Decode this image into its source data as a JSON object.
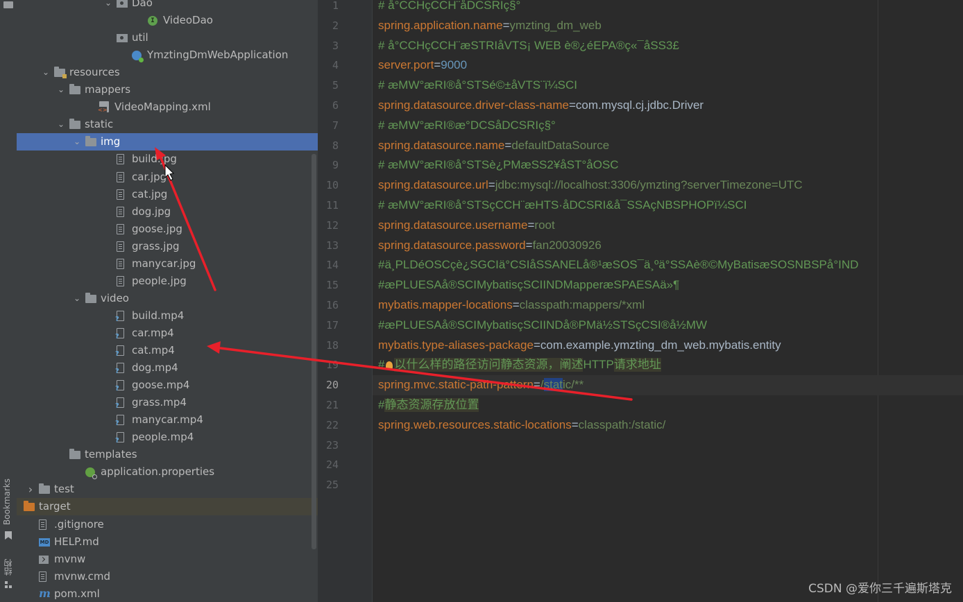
{
  "tool_strip": {
    "bookmarks_label": "Bookmarks",
    "structure_label": "结构"
  },
  "project_tree": {
    "items": [
      {
        "label": "Dao",
        "icon": "package-icon",
        "expanded": true
      },
      {
        "label": "VideoDao",
        "icon": "interface-icon"
      },
      {
        "label": "util",
        "icon": "package-icon"
      },
      {
        "label": "YmztingDmWebApplication",
        "icon": "spring-app-class-icon"
      },
      {
        "label": "resources",
        "icon": "resources-folder-icon",
        "expanded": true
      },
      {
        "label": "mappers",
        "icon": "folder-icon",
        "expanded": true
      },
      {
        "label": "VideoMapping.xml",
        "icon": "xml-file-icon"
      },
      {
        "label": "static",
        "icon": "folder-icon",
        "expanded": true
      },
      {
        "label": "img",
        "icon": "folder-icon",
        "expanded": true,
        "selected": true
      },
      {
        "label": "build.jpg",
        "icon": "image-file-icon"
      },
      {
        "label": "car.jpg",
        "icon": "image-file-icon"
      },
      {
        "label": "cat.jpg",
        "icon": "image-file-icon"
      },
      {
        "label": "dog.jpg",
        "icon": "image-file-icon"
      },
      {
        "label": "goose.jpg",
        "icon": "image-file-icon"
      },
      {
        "label": "grass.jpg",
        "icon": "image-file-icon"
      },
      {
        "label": "manycar.jpg",
        "icon": "image-file-icon"
      },
      {
        "label": "people.jpg",
        "icon": "image-file-icon"
      },
      {
        "label": "video",
        "icon": "folder-icon",
        "expanded": true
      },
      {
        "label": "build.mp4",
        "icon": "unknown-file-icon"
      },
      {
        "label": "car.mp4",
        "icon": "unknown-file-icon"
      },
      {
        "label": "cat.mp4",
        "icon": "unknown-file-icon"
      },
      {
        "label": "dog.mp4",
        "icon": "unknown-file-icon"
      },
      {
        "label": "goose.mp4",
        "icon": "unknown-file-icon"
      },
      {
        "label": "grass.mp4",
        "icon": "unknown-file-icon"
      },
      {
        "label": "manycar.mp4",
        "icon": "unknown-file-icon"
      },
      {
        "label": "people.mp4",
        "icon": "unknown-file-icon"
      },
      {
        "label": "templates",
        "icon": "folder-icon"
      },
      {
        "label": "application.properties",
        "icon": "properties-file-icon"
      },
      {
        "label": "test",
        "icon": "folder-icon",
        "expanded": false
      },
      {
        "label": "target",
        "icon": "excluded-folder-icon",
        "expanded": false
      },
      {
        "label": ".gitignore",
        "icon": "gitignore-file-icon"
      },
      {
        "label": "HELP.md",
        "icon": "markdown-file-icon"
      },
      {
        "label": "mvnw",
        "icon": "shell-script-icon"
      },
      {
        "label": "mvnw.cmd",
        "icon": "text-file-icon"
      },
      {
        "label": "pom.xml",
        "icon": "maven-icon"
      }
    ]
  },
  "editor": {
    "current_line": 20,
    "lines": [
      {
        "num": "1",
        "parts": [
          {
            "t": "# å°CCHçCCH¨åDCSRIç§°",
            "c": "c"
          }
        ]
      },
      {
        "num": "2",
        "parts": [
          {
            "t": "spring.application.name",
            "c": "k"
          },
          {
            "t": "=",
            "c": "e"
          },
          {
            "t": "ymzting_dm_web",
            "c": "v"
          }
        ]
      },
      {
        "num": "3",
        "parts": [
          {
            "t": "# å°CCHçCCH¨æSTRIåVTS¡ WEB è®¿éEPA®ç«¯åSS3£",
            "c": "c"
          }
        ]
      },
      {
        "num": "4",
        "parts": [
          {
            "t": "server.port",
            "c": "k"
          },
          {
            "t": "=",
            "c": "e"
          },
          {
            "t": "9000",
            "c": "n"
          }
        ]
      },
      {
        "num": "5",
        "parts": [
          {
            "t": "# æMW°æRI®å°STSé©±åVTS¨ï¼SCI",
            "c": "c"
          }
        ]
      },
      {
        "num": "6",
        "parts": [
          {
            "t": "spring.datasource.driver-class-name",
            "c": "k"
          },
          {
            "t": "=",
            "c": "e"
          },
          {
            "t": "com.mysql.cj.jdbc.Driver",
            "c": "e"
          }
        ]
      },
      {
        "num": "7",
        "parts": [
          {
            "t": "# æMW°æRI®æ°DCSåDCSRIç§°",
            "c": "c"
          }
        ]
      },
      {
        "num": "8",
        "parts": [
          {
            "t": "spring.datasource.name",
            "c": "k"
          },
          {
            "t": "=",
            "c": "e"
          },
          {
            "t": "defaultDataSource",
            "c": "v"
          }
        ]
      },
      {
        "num": "9",
        "parts": [
          {
            "t": "# æMW°æRI®å°STSè¿PMæSS2¥åST°åOSC",
            "c": "c"
          }
        ]
      },
      {
        "num": "10",
        "parts": [
          {
            "t": "spring.datasource.url",
            "c": "k"
          },
          {
            "t": "=",
            "c": "e"
          },
          {
            "t": "jdbc:mysql://localhost:3306/ymzting?serverTimezone=UTC",
            "c": "v"
          }
        ]
      },
      {
        "num": "11",
        "parts": [
          {
            "t": "# æMW°æRI®å°STSçCCH¨æHTS·åDCSRI&å¯SSAçNBSPHOPï¼SCI",
            "c": "c"
          }
        ]
      },
      {
        "num": "12",
        "parts": [
          {
            "t": "spring.datasource.username",
            "c": "k"
          },
          {
            "t": "=",
            "c": "e"
          },
          {
            "t": "root",
            "c": "v"
          }
        ]
      },
      {
        "num": "13",
        "parts": [
          {
            "t": "spring.datasource.password",
            "c": "k"
          },
          {
            "t": "=",
            "c": "e"
          },
          {
            "t": "fan20030926",
            "c": "v"
          }
        ]
      },
      {
        "num": "14",
        "parts": [
          {
            "t": "#ä¸PLDéOSCçè¿SGCIä°CSIåSSANELå®¹æSOS¯ä¸ºä°SSAè®©MyBatisæSOSNBSPå°IND",
            "c": "c"
          }
        ]
      },
      {
        "num": "15",
        "parts": [
          {
            "t": "#æPLUESAå®SCIMybatisçSCIINDMapperæSPAESAä»¶",
            "c": "c"
          }
        ]
      },
      {
        "num": "16",
        "parts": [
          {
            "t": "mybatis.mapper-locations",
            "c": "k"
          },
          {
            "t": "=",
            "c": "e"
          },
          {
            "t": "classpath:mappers/*xml",
            "c": "v"
          }
        ]
      },
      {
        "num": "17",
        "parts": [
          {
            "t": "#æPLUESAå®SCIMybatisçSCIINDå®PMä½STSçCSI®å½MW",
            "c": "c"
          }
        ]
      },
      {
        "num": "18",
        "parts": [
          {
            "t": "mybatis.type-aliases-package",
            "c": "k"
          },
          {
            "t": "=",
            "c": "e"
          },
          {
            "t": "com.example.ymzting_dm_web.mybatis.entity",
            "c": "e"
          }
        ]
      },
      {
        "num": "19",
        "parts": [
          {
            "t": "#",
            "c": "c"
          },
          {
            "t": "",
            "c": "bulb"
          },
          {
            "t": "以什么样的路径访问静态资源，阐述",
            "c": "cn"
          },
          {
            "t": "HTTP",
            "c": "c"
          },
          {
            "t": "请求地址",
            "c": "cn"
          }
        ]
      },
      {
        "num": "20",
        "parts": [
          {
            "t": "spring.mvc.static-path-pattern",
            "c": "k"
          },
          {
            "t": "=",
            "c": "e"
          },
          {
            "t": "/",
            "c": "v"
          },
          {
            "t": "stat",
            "c": "v sh"
          },
          {
            "t": "ic/**",
            "c": "v"
          }
        ]
      },
      {
        "num": "21",
        "parts": [
          {
            "t": "#",
            "c": "c"
          },
          {
            "t": "静态资源存放位置",
            "c": "cn"
          }
        ]
      },
      {
        "num": "22",
        "parts": [
          {
            "t": "spring.web.resources.static-locations",
            "c": "k"
          },
          {
            "t": "=",
            "c": "e"
          },
          {
            "t": "classpath:/static/",
            "c": "v"
          }
        ]
      },
      {
        "num": "23",
        "parts": []
      },
      {
        "num": "24",
        "parts": []
      },
      {
        "num": "25",
        "parts": []
      }
    ]
  },
  "watermark": "CSDN @爱你三千遍斯塔克",
  "colors": {
    "selection": "#4b6eaf",
    "keyword": "#cc7832",
    "value": "#6a8759",
    "number": "#6897bb",
    "comment": "#629755",
    "annotation_arrow": "#e8202a"
  }
}
